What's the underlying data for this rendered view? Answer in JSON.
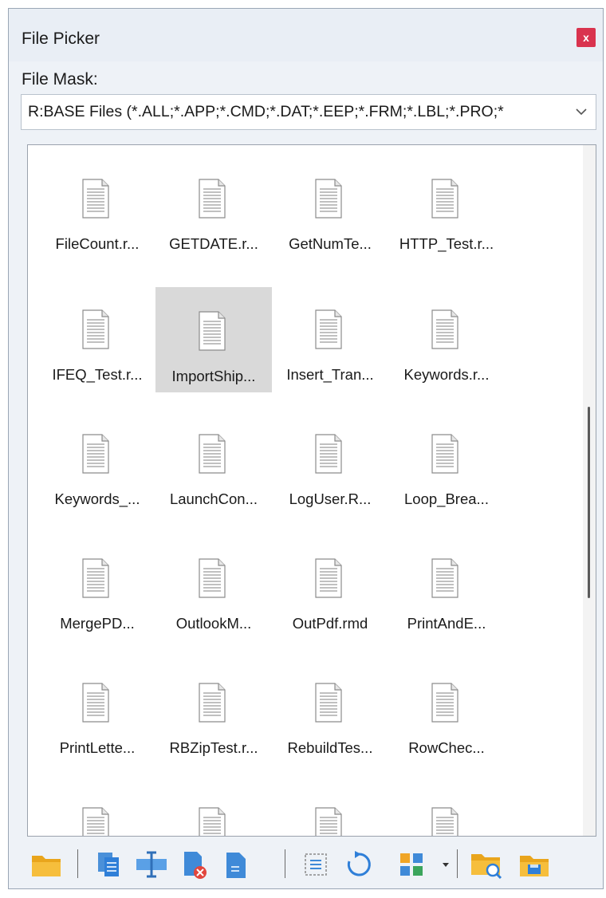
{
  "window": {
    "title": "File Picker",
    "close_label": "x"
  },
  "file_mask": {
    "label": "File Mask:",
    "value": "R:BASE Files (*.ALL;*.APP;*.CMD;*.DAT;*.EEP;*.FRM;*.LBL;*.PRO;*"
  },
  "files": [
    {
      "name": "FileCount.r..."
    },
    {
      "name": "GETDATE.r..."
    },
    {
      "name": "GetNumTe..."
    },
    {
      "name": "HTTP_Test.r..."
    },
    {
      "name": "IFEQ_Test.r..."
    },
    {
      "name": "ImportShip...",
      "selected": true
    },
    {
      "name": "Insert_Tran..."
    },
    {
      "name": "Keywords.r..."
    },
    {
      "name": "Keywords_..."
    },
    {
      "name": "LaunchCon..."
    },
    {
      "name": "LogUser.R..."
    },
    {
      "name": "Loop_Brea..."
    },
    {
      "name": "MergePD..."
    },
    {
      "name": "OutlookM..."
    },
    {
      "name": "OutPdf.rmd"
    },
    {
      "name": "PrintAndE..."
    },
    {
      "name": "PrintLette..."
    },
    {
      "name": "RBZipTest.r..."
    },
    {
      "name": "RebuildTes..."
    },
    {
      "name": "RowChec..."
    },
    {
      "name": ""
    },
    {
      "name": ""
    },
    {
      "name": ""
    },
    {
      "name": ""
    }
  ],
  "toolbar": {
    "buttons": [
      {
        "icon": "open-folder-icon"
      },
      {
        "icon": "copy-file-icon"
      },
      {
        "icon": "rename-icon"
      },
      {
        "icon": "delete-file-icon"
      },
      {
        "icon": "new-file-icon"
      },
      {
        "icon": "select-all-icon"
      },
      {
        "icon": "refresh-icon"
      },
      {
        "icon": "view-mode-icon"
      },
      {
        "icon": "browse-folder-icon"
      },
      {
        "icon": "save-location-icon"
      }
    ]
  },
  "colors": {
    "accent": "#2f7fd8",
    "folder": "#f5b72a",
    "close": "#d9334e",
    "selection": "#d9d9d9"
  }
}
